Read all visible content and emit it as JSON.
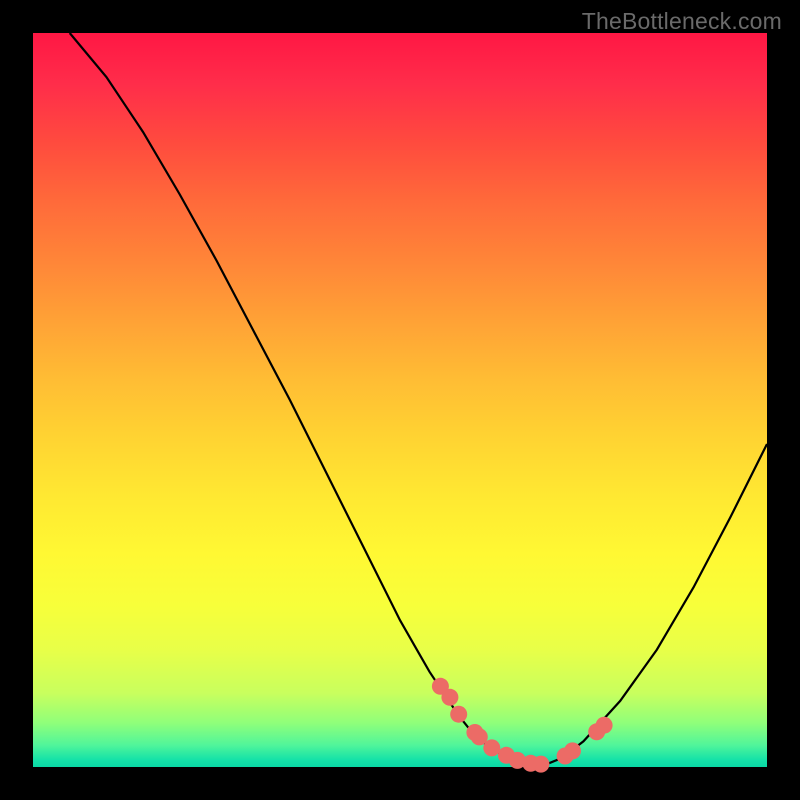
{
  "watermark": "TheBottleneck.com",
  "chart_data": {
    "type": "line",
    "title": "",
    "xlabel": "",
    "ylabel": "",
    "xlim": [
      0,
      100
    ],
    "ylim": [
      0,
      100
    ],
    "curve": {
      "x": [
        5,
        10,
        15,
        20,
        25,
        30,
        35,
        40,
        45,
        50,
        52,
        54,
        56,
        58,
        60,
        62,
        64,
        66,
        68,
        70,
        72,
        75,
        80,
        85,
        90,
        95,
        100
      ],
      "y": [
        100,
        94,
        86.5,
        78,
        69,
        59.5,
        50,
        40,
        30,
        20,
        16.5,
        13,
        10,
        7,
        4.5,
        2.8,
        1.6,
        0.8,
        0.4,
        0.4,
        1.2,
        3.5,
        9,
        16,
        24.5,
        34,
        44
      ]
    },
    "dots": {
      "x": [
        55.5,
        56.8,
        58.0,
        60.2,
        60.8,
        62.5,
        64.5,
        66.0,
        67.8,
        69.2,
        72.5,
        73.5,
        76.8,
        77.8
      ],
      "y": [
        11.0,
        9.5,
        7.2,
        4.7,
        4.1,
        2.6,
        1.6,
        0.9,
        0.5,
        0.4,
        1.5,
        2.2,
        4.8,
        5.7
      ]
    },
    "colors": {
      "curve": "#000000",
      "dots": "#ec6b66"
    }
  }
}
